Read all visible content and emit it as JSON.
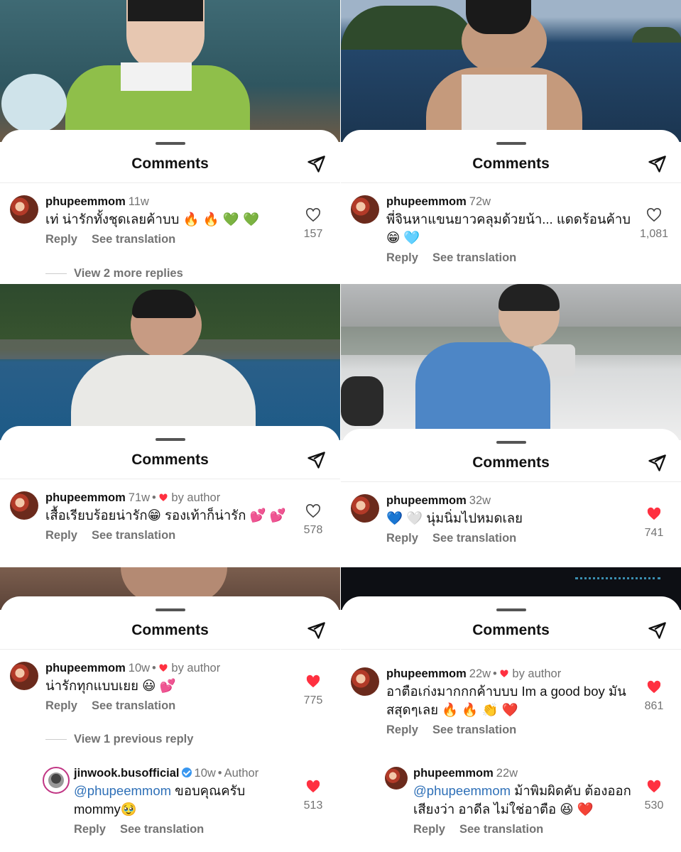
{
  "colors": {
    "heart_red": "#ff3040",
    "mention_blue": "#2d6fb7",
    "secondary_text": "#737373"
  },
  "panels": [
    {
      "sheet_title": "Comments",
      "comment": {
        "username": "phupeemmom",
        "age": "11w",
        "text": "เท่ น่ารักทั้งชุดเลยค้าบบ 🔥 🔥 💚 💚",
        "reply_label": "Reply",
        "translate_label": "See translation",
        "likes": "157",
        "liked": false
      },
      "view_more": "View 2 more replies"
    },
    {
      "sheet_title": "Comments",
      "comment": {
        "username": "phupeemmom",
        "age": "72w",
        "text": "พี่จินหาแขนยาวคลุมด้วยน้า... แดดร้อนค้าบ 😁 🩵",
        "reply_label": "Reply",
        "translate_label": "See translation",
        "likes": "1,081",
        "liked": false
      }
    },
    {
      "sheet_title": "Comments",
      "comment": {
        "username": "phupeemmom",
        "age": "71w",
        "by_author": "by author",
        "text": "เสื้อเรียบร้อยน่ารัก😁 รองเท้าก็น่ารัก 💕 💕",
        "reply_label": "Reply",
        "translate_label": "See translation",
        "likes": "578",
        "liked": false
      }
    },
    {
      "sheet_title": "Comments",
      "comment": {
        "username": "phupeemmom",
        "age": "32w",
        "text": "💙 🤍 นุ่มนิ่มไปหมดเลย",
        "reply_label": "Reply",
        "translate_label": "See translation",
        "likes": "741",
        "liked": true
      }
    },
    {
      "sheet_title": "Comments",
      "comment": {
        "username": "phupeemmom",
        "age": "10w",
        "by_author": "by author",
        "text": "น่ารักทุกแบบเยย 😃 💕",
        "reply_label": "Reply",
        "translate_label": "See translation",
        "likes": "775",
        "liked": true
      },
      "view_more": "View 1 previous reply",
      "reply": {
        "username": "jinwook.busofficial",
        "age": "10w",
        "tag": "Author",
        "mention": "@phupeemmom",
        "text": " ขอบคุณครับ mommy🥹",
        "reply_label": "Reply",
        "translate_label": "See translation",
        "likes": "513",
        "liked": true
      }
    },
    {
      "sheet_title": "Comments",
      "comment": {
        "username": "phupeemmom",
        "age": "22w",
        "by_author": "by author",
        "text": "อาตือเก่งมากกกค้าบบบ Im a good boy มันสสุดๆเลย 🔥 🔥 👏 ❤️",
        "reply_label": "Reply",
        "translate_label": "See translation",
        "likes": "861",
        "liked": true
      },
      "reply": {
        "username": "phupeemmom",
        "age": "22w",
        "mention": "@phupeemmom",
        "text": " ม้าพิมผิดคับ ต้องออกเสียงว่า อาดีล ไม่ใช่อาตือ 😆 ❤️",
        "reply_label": "Reply",
        "translate_label": "See translation",
        "likes": "530",
        "liked": true
      }
    }
  ]
}
